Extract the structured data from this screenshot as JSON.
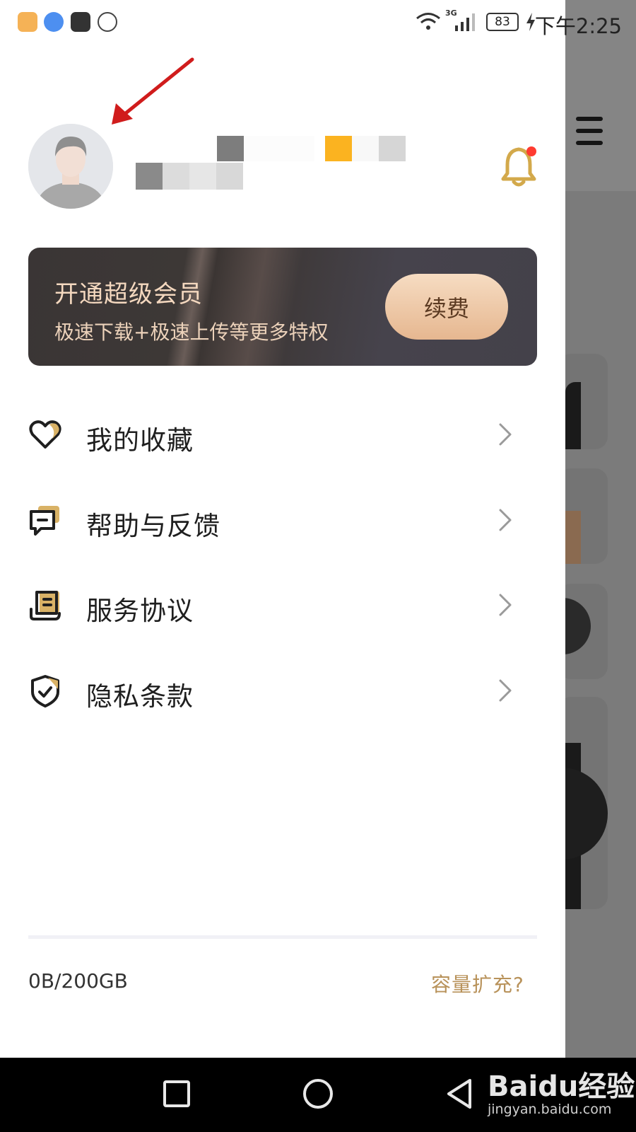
{
  "status_bar": {
    "time": "下午2:25",
    "battery": "83",
    "network": "3G"
  },
  "vip": {
    "title": "开通超级会员",
    "subtitle": "极速下载+极速上传等更多特权",
    "button": "续费"
  },
  "menu": [
    {
      "label": "我的收藏",
      "icon": "heart-icon"
    },
    {
      "label": "帮助与反馈",
      "icon": "feedback-icon"
    },
    {
      "label": "服务协议",
      "icon": "document-icon"
    },
    {
      "label": "隐私条款",
      "icon": "shield-check-icon"
    }
  ],
  "footer": {
    "storage": "0B/200GB",
    "expand_link": "容量扩充?"
  },
  "watermark": {
    "logo": "Baidu经验",
    "url": "jingyan.baidu.com"
  },
  "colors": {
    "accent_gold": "#b8925a",
    "bell": "#d3a94b",
    "notification_dot": "#ff3b30",
    "annotation_arrow": "#d01c1c"
  }
}
